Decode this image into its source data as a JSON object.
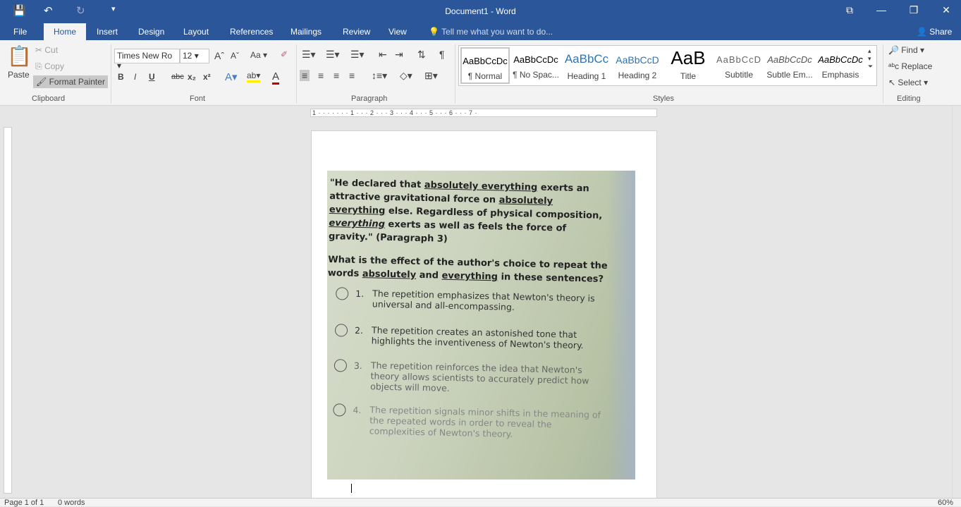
{
  "window": {
    "title": "Document1 - Word"
  },
  "quick_access": {
    "save": "save-icon",
    "undo": "undo-icon",
    "redo": "redo-icon"
  },
  "tabs": [
    "File",
    "Home",
    "Insert",
    "Design",
    "Layout",
    "References",
    "Mailings",
    "Review",
    "View"
  ],
  "tell_me": "Tell me what you want to do...",
  "share": "Share",
  "clipboard": {
    "paste": "Paste",
    "cut": "Cut",
    "copy": "Copy",
    "format_painter": "Format Painter",
    "label": "Clipboard"
  },
  "font": {
    "name": "Times New Ro",
    "size": "12",
    "label": "Font",
    "change_case": "Aa",
    "bold": "B",
    "italic": "I",
    "underline": "U",
    "strike": "abc",
    "sub": "x₂",
    "sup": "x²",
    "color": "A"
  },
  "paragraph": {
    "label": "Paragraph"
  },
  "styles": {
    "label": "Styles",
    "items": [
      {
        "preview": "AaBbCcDc",
        "name": "¶ Normal"
      },
      {
        "preview": "AaBbCcDc",
        "name": "¶ No Spac..."
      },
      {
        "preview": "AaBbCc",
        "name": "Heading 1"
      },
      {
        "preview": "AaBbCcD",
        "name": "Heading 2"
      },
      {
        "preview": "AaB",
        "name": "Title"
      },
      {
        "preview": "AaBbCcD",
        "name": "Subtitle"
      },
      {
        "preview": "AaBbCcDc",
        "name": "Subtle Em..."
      },
      {
        "preview": "AaBbCcDc",
        "name": "Emphasis"
      }
    ]
  },
  "editing": {
    "find": "Find",
    "replace": "Replace",
    "select": "Select",
    "label": "Editing"
  },
  "ruler": "1 · · · · · · · 1 · · · 2 · · · 3 · · · 4 · · · 5 · · · 6 · · · 7 ·",
  "photo": {
    "quote_a": "\"He declared that ",
    "u1": "absolutely everything",
    "quote_b": " exerts an attractive gravitational force on ",
    "u2": "absolutely everything",
    "quote_c": " else. Regardless of physical composition, ",
    "u3": "everything",
    "quote_d": " exerts as well as feels the force of gravity.\" (Paragraph 3)",
    "q_a": "What is the effect of the author's choice to repeat the words ",
    "q_u1": "absolutely",
    "q_b": " and ",
    "q_u2": "everything",
    "q_c": " in these sentences?",
    "options": [
      {
        "num": "1.",
        "text": "The repetition emphasizes that Newton's theory is universal and all-encompassing."
      },
      {
        "num": "2.",
        "text": "The repetition creates an astonished tone that highlights the inventiveness of Newton's theory."
      },
      {
        "num": "3.",
        "text": "The repetition reinforces the idea that Newton's theory allows scientists to accurately predict how objects will move."
      },
      {
        "num": "4.",
        "text": "The repetition signals minor shifts in the meaning of the repeated words in order to reveal the complexities of Newton's theory."
      }
    ]
  },
  "status": {
    "page": "Page 1 of 1",
    "words": "0 words",
    "zoom": "60%"
  }
}
